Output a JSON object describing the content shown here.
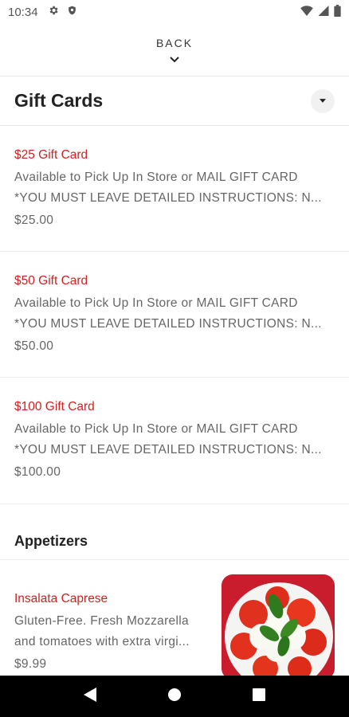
{
  "status_bar": {
    "time": "10:34",
    "icons": [
      "gear-icon",
      "shield-icon",
      "wifi-icon",
      "signal-icon",
      "battery-icon"
    ]
  },
  "back_header": {
    "label": "BACK"
  },
  "gift_section": {
    "title": "Gift Cards",
    "items": [
      {
        "name": "$25 Gift Card",
        "desc_line1": "Available to Pick Up In Store or MAIL GIFT CARD",
        "desc_line2": "*YOU MUST LEAVE DETAILED INSTRUCTIONS: N...",
        "price": "$25.00"
      },
      {
        "name": "$50 Gift Card",
        "desc_line1": "Available to Pick Up In Store or MAIL GIFT CARD",
        "desc_line2": "*YOU MUST LEAVE DETAILED INSTRUCTIONS: N...",
        "price": "$50.00"
      },
      {
        "name": "$100 Gift Card",
        "desc_line1": "Available to Pick Up In Store or MAIL GIFT CARD",
        "desc_line2": "*YOU MUST LEAVE DETAILED INSTRUCTIONS: N...",
        "price": "$100.00"
      }
    ]
  },
  "appetizers": {
    "title": "Appetizers",
    "items": [
      {
        "name": "Insalata Caprese",
        "desc_line1": "Gluten-Free. Fresh Mozzarella",
        "desc_line2": "and tomatoes with extra virgi...",
        "price": "$9.99"
      }
    ]
  },
  "colors": {
    "accent": "#d42020",
    "text_muted": "#666666"
  }
}
